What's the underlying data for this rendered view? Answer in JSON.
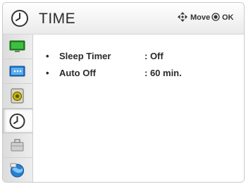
{
  "header": {
    "title": "TIME",
    "icon": "clock-icon",
    "hints": [
      {
        "icon": "move-arrows-icon",
        "label": "Move"
      },
      {
        "icon": "ok-button-icon",
        "label": "OK"
      }
    ]
  },
  "sidebar": {
    "items": [
      {
        "icon": "picture-icon",
        "active": false
      },
      {
        "icon": "channel-icon",
        "active": false
      },
      {
        "icon": "audio-icon",
        "active": false
      },
      {
        "icon": "time-icon",
        "active": true
      },
      {
        "icon": "lock-icon",
        "active": false
      },
      {
        "icon": "option-globe-icon",
        "active": false
      }
    ]
  },
  "menu": {
    "bullet": "•",
    "rows": [
      {
        "label": "Sleep Timer",
        "value": ": Off"
      },
      {
        "label": "Auto Off",
        "value": ": 60 min."
      }
    ]
  },
  "colors": {
    "accent_green": "#2e9e2e",
    "accent_blue": "#2a7fd0",
    "text": "#2b2b2b"
  }
}
